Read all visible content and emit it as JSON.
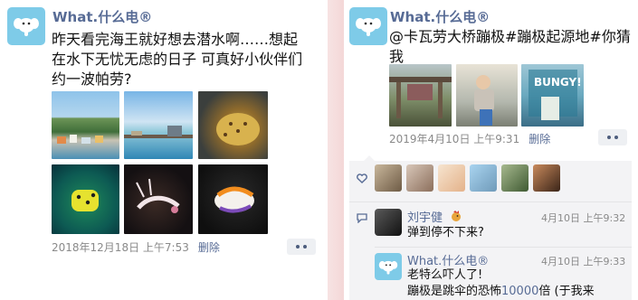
{
  "colors": {
    "accent": "#576b95",
    "avatar_bg": "#7ecbe8",
    "interaction_bg": "#f3f3f5"
  },
  "left_post": {
    "username": "What.什么电®",
    "text": "昨天看完海王就好想去潜水啊……想起\n在水下无忧无虑的日子 可真好小伙伴们\n约一波帕劳?",
    "photos": [
      "island-town",
      "beach-pier",
      "pufferfish",
      "yellow-boxfish",
      "shrimp",
      "nudibranch"
    ],
    "timestamp": "2018年12月18日 上午7:53",
    "delete_label": "删除"
  },
  "right_post": {
    "username": "What.什么电®",
    "text": "@卡瓦劳大桥蹦极#蹦极起源地#你猜我\n怎么了?",
    "photos": [
      "bridge-bungy",
      "jumper-woman",
      "bungy-sign"
    ],
    "bungy_sign_text": "BUNGY!",
    "timestamp": "2019年4月10日 上午9:31",
    "delete_label": "删除",
    "likes": {
      "icon": "heart-icon",
      "avatars": [
        "avatar-1",
        "avatar-2",
        "avatar-3",
        "avatar-4",
        "avatar-5",
        "avatar-6"
      ]
    },
    "comments": [
      {
        "name": "刘宇健",
        "badge": "rooster-emoji",
        "time": "4月10日 上午9:32",
        "text": "弹到停不下来?"
      },
      {
        "name": "What.什么电®",
        "time": "4月10日 上午9:33",
        "line1": "老特么吓人了!",
        "line2_pre": "蹦极是跳伞的恐怖",
        "line2_hl": "10000",
        "line2_post": "倍 (于我来"
      }
    ]
  }
}
